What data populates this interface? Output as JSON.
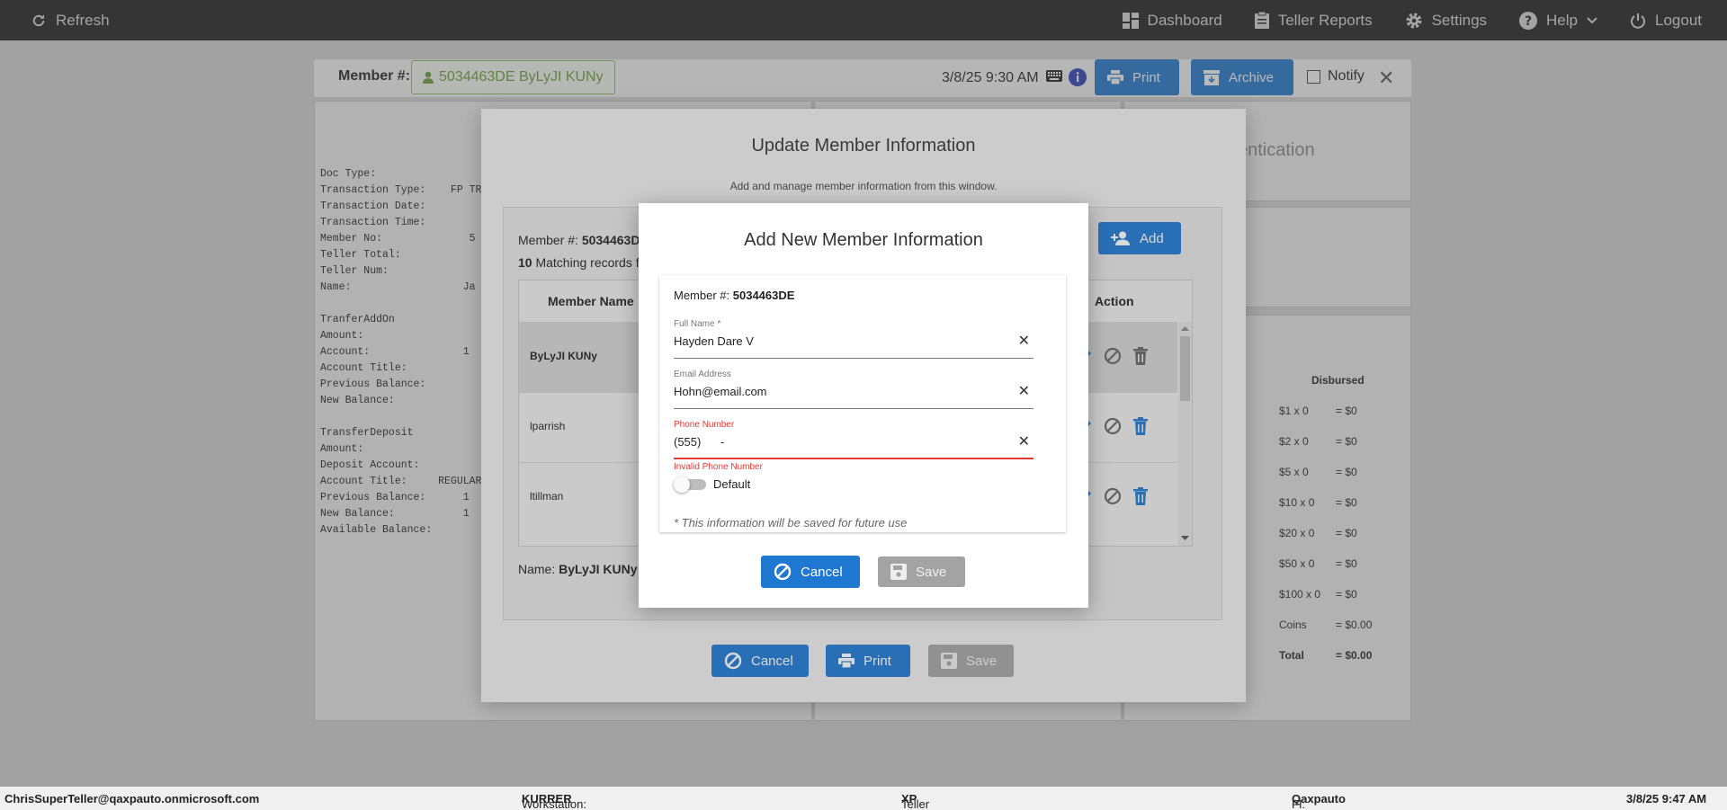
{
  "topnav": {
    "refresh_label": "Refresh",
    "dashboard_label": "Dashboard",
    "teller_reports_label": "Teller Reports",
    "settings_label": "Settings",
    "help_label": "Help",
    "logout_label": "Logout"
  },
  "member_bar": {
    "label": "Member #:",
    "member_chip": "5034463DE ByLyJI KUNy",
    "datetime": "3/8/25 9:30 AM",
    "print_label": "Print",
    "archive_label": "Archive",
    "notify_label": "Notify"
  },
  "receipt": {
    "lines": [
      "Doc Type:",
      "Transaction Type:    FP TRA",
      "Transaction Date:",
      "Transaction Time:",
      "Member No:              5",
      "Teller Total:",
      "Teller Num:",
      "Name:                  Ja",
      "",
      "TranferAddOn",
      "Amount:",
      "Account:               1",
      "Account Title:",
      "Previous Balance:",
      "New Balance:",
      "",
      "TransferDeposit",
      "Amount:",
      "Deposit Account:",
      "Account Title:     REGULAR",
      "Previous Balance:      1",
      "New Balance:           1",
      "Available Balance:"
    ]
  },
  "auth_panel": {
    "title_fragment": "entication"
  },
  "disbursed": {
    "header": "Disbursed",
    "rows": [
      {
        "denom": "$1 x 0",
        "value": "= $0"
      },
      {
        "denom": "$2 x 0",
        "value": "= $0"
      },
      {
        "denom": "$5 x 0",
        "value": "= $0"
      },
      {
        "denom": "$10 x 0",
        "value": "= $0"
      },
      {
        "denom": "$20 x 0",
        "value": "= $0"
      },
      {
        "denom": "$50 x 0",
        "value": "= $0"
      },
      {
        "denom": "$100 x 0",
        "value": "= $0"
      },
      {
        "denom": "Coins",
        "value": "= $0.00"
      },
      {
        "denom": "Total",
        "value": "= $0.00"
      }
    ]
  },
  "update_dialog": {
    "title": "Update Member Information",
    "subtitle": "Add and manage member information from this window.",
    "member_label": "Member #:",
    "member_value": "5034463D",
    "matching_count": "10",
    "matching_text": "Matching records f",
    "add_label": "Add",
    "col_member_name": "Member Name",
    "col_action": "Action",
    "rows": [
      {
        "name": "ByLyJI KUNy"
      },
      {
        "name": "lparrish"
      },
      {
        "name": "ltillman"
      }
    ],
    "name_label": "Name:",
    "name_value": "ByLyJI KUNy",
    "cancel_label": "Cancel",
    "print_label": "Print",
    "save_label": "Save"
  },
  "add_dialog": {
    "title": "Add New Member Information",
    "member_label": "Member #:",
    "member_value": "5034463DE",
    "full_name_label": "Full Name *",
    "full_name_value": "Hayden Dare V",
    "email_label": "Email Address",
    "email_value": "Hohn@email.com",
    "phone_label": "Phone Number",
    "phone_value": "(555)      -",
    "phone_error": "Invalid Phone Number",
    "default_label": "Default",
    "default_on": false,
    "note": "* This information will be saved for future use",
    "cancel_label": "Cancel",
    "save_label": "Save"
  },
  "statusbar": {
    "user": "ChrisSuperTeller@qaxpauto.onmicrosoft.com",
    "workstation_label": "Workstation:",
    "workstation_value": "KURRER",
    "platform_label": "Teller Platform:",
    "platform_value": "XP",
    "fi_label": "FI:",
    "fi_value": "Qaxpauto",
    "datetime": "3/8/25 9:47 AM"
  },
  "colors": {
    "accent": "#1e78d2",
    "error": "#e53935",
    "member_chip": "#6aa03a",
    "nav_bg": "#1f1f1f"
  }
}
